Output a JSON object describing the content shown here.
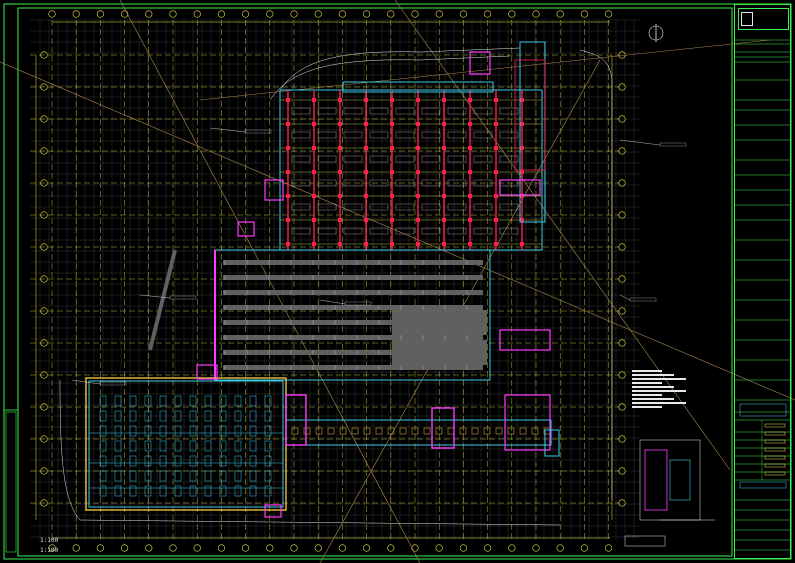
{
  "drawing": {
    "scale_label_1": "1:100",
    "scale_label_2": "1:100"
  },
  "title_block": {
    "logo_line_1": "",
    "logo_line_2": ""
  },
  "colors": {
    "background": "#000000",
    "frame": "#3cf04a",
    "grid_major": "#e6e64a",
    "grid_minor": "#4a4a4a",
    "column": "#ff1e50",
    "wall_cyan": "#3ccce6",
    "wall_magenta": "#ff3cff",
    "wall_yellow": "#f0c040",
    "hatch_gray": "#606060",
    "diagonal": "#b08a50",
    "text_white": "#e8e8e8"
  }
}
